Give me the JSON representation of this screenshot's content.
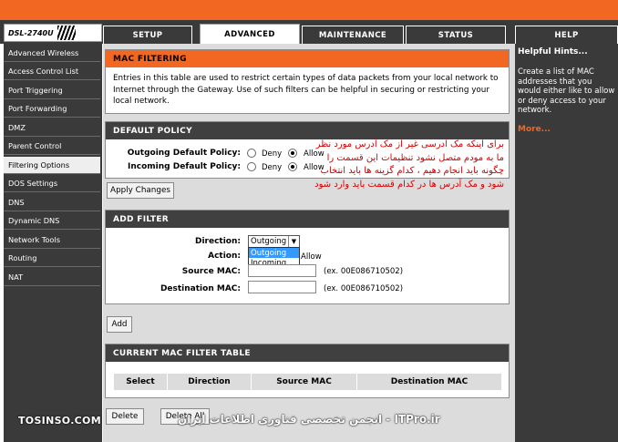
{
  "header": {
    "model": "DSL-2740U",
    "tabs": [
      "SETUP",
      "ADVANCED",
      "MAINTENANCE",
      "STATUS",
      "HELP"
    ]
  },
  "sidebar": {
    "items": [
      "Advanced Wireless",
      "Access Control List",
      "Port Triggering",
      "Port Forwarding",
      "DMZ",
      "Parent Control",
      "Filtering Options",
      "DOS Settings",
      "DNS",
      "Dynamic DNS",
      "Network Tools",
      "Routing",
      "NAT"
    ]
  },
  "mac_filtering": {
    "title": "MAC FILTERING",
    "description": "Entries in this table are used to restrict certain types of data packets from your local network to Internet through the Gateway. Use of such filters can be helpful in securing or restricting your local network."
  },
  "default_policy": {
    "title": "DEFAULT POLICY",
    "outgoing_label": "Outgoing Default Policy:",
    "incoming_label": "Incoming Default Policy:",
    "deny": "Deny",
    "allow": "Allow",
    "apply_button": "Apply Changes"
  },
  "add_filter": {
    "title": "ADD FILTER",
    "direction_label": "Direction:",
    "direction_value": "Outgoing",
    "direction_options": [
      "Outgoing",
      "Incoming"
    ],
    "action_label": "Action:",
    "action_visible_text": "Allow",
    "source_mac_label": "Source MAC:",
    "source_mac_hint": "(ex. 00E086710502)",
    "dest_mac_label": "Destination MAC:",
    "dest_mac_hint": "(ex. 00E086710502)",
    "add_button": "Add"
  },
  "mac_table": {
    "title": "CURRENT MAC FILTER TABLE",
    "columns": [
      "Select",
      "Direction",
      "Source MAC",
      "Destination MAC"
    ],
    "delete_button": "Delete",
    "delete_all_button": "Delete All"
  },
  "help": {
    "title": "Helpful Hints...",
    "text": "Create a list of MAC addresses that you would either like to allow or deny access to your network.",
    "more": "More..."
  },
  "annotation": {
    "text": "برای اینکه مک آدرسی غیر از مک آدرس مورد نظر ما به مودم متصل نشود تنظیمات این قسمت را چگونه باید انجام دهیم ، کدام گزینه ها باید انتخاب شود و مک آدرس ها در کدام قسمت باید وارد شود"
  },
  "watermark": {
    "left": "TOSINSO.COM",
    "right": "ITPro.ir - انجمن تخصصی فناوری اطلاعات ایران"
  },
  "colors": {
    "accent": "#f26722",
    "dark": "#3a3a3a",
    "annotation": "#d40000"
  }
}
